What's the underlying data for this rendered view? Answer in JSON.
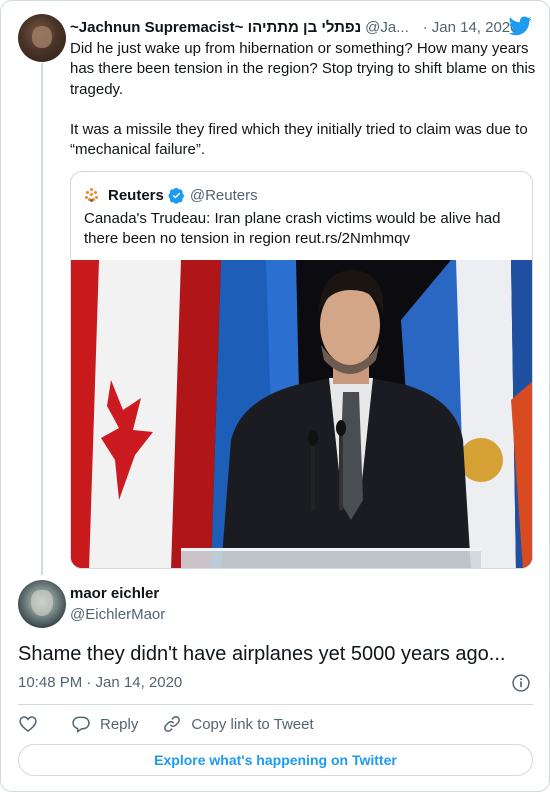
{
  "parent_tweet": {
    "display_name": "~Jachnun Supremacist~ נפתלי בן מתתיהו",
    "handle": "@Ja...",
    "separator": "·",
    "date": "Jan 14, 2020",
    "paragraphs": [
      "Did he just wake up from hibernation or something? How many years has there been tension in the region? Stop trying to shift blame on this tragedy.",
      "It was a missile they fired which they initially tried to claim was due to “mechanical failure”."
    ]
  },
  "quoted_tweet": {
    "display_name": "Reuters",
    "handle": "@Reuters",
    "text": "Canada's Trudeau: Iran plane crash victims would be alive had there been no tension in region reut.rs/2Nmhmqv"
  },
  "main_tweet": {
    "display_name": "maor eichler",
    "handle": "@EichlerMaor",
    "text": "Shame they didn't have airplanes yet 5000 years ago...",
    "timestamp": "10:48 PM · Jan 14, 2020"
  },
  "actions": {
    "reply_label": "Reply",
    "copy_link_label": "Copy link to Tweet"
  },
  "explore_label": "Explore what's happening on Twitter",
  "icons": {
    "brand": "twitter-bird-icon",
    "verified": "verified-badge-icon",
    "like": "heart-icon",
    "reply": "reply-bubble-icon",
    "copy": "link-icon",
    "info": "info-icon"
  },
  "colors": {
    "accent": "#1d9bf0",
    "text_primary": "#0f1419",
    "text_secondary": "#536471",
    "border": "#cfd9de"
  }
}
